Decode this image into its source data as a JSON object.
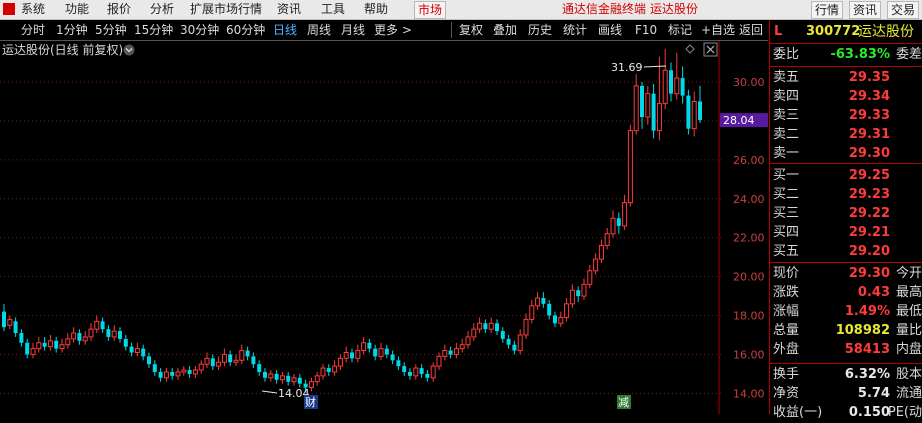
{
  "menubar": {
    "items": [
      "系统",
      "功能",
      "报价",
      "分析",
      "扩展市场行情",
      "资讯",
      "工具",
      "帮助"
    ],
    "market_tab": "市场",
    "title_prefix": "通达信金融终端",
    "title_stock": "运达股份",
    "right_buttons": [
      "行情",
      "资讯",
      "交易"
    ]
  },
  "toolbar": {
    "periods": [
      "分时",
      "1分钟",
      "5分钟",
      "15分钟",
      "30分钟",
      "60分钟",
      "日线",
      "周线",
      "月线",
      "更多 >"
    ],
    "active_period": "日线",
    "actions": [
      "复权",
      "叠加",
      "历史",
      "统计",
      "画线",
      "F10",
      "标记",
      "+自选",
      "返回"
    ]
  },
  "chart": {
    "title": "运达股份(日线 前复权)",
    "current_price_label": "28.04",
    "high_label": "31.69",
    "low_label": "14.04",
    "marker_cai": "财",
    "marker_jian": "减",
    "colors": {
      "up": "#ff3b3b",
      "down": "#00d9e8",
      "grid": "#7a1414",
      "tag_bg": "#5a1aa0"
    }
  },
  "chart_data": {
    "type": "candlestick",
    "y_ticks": [
      14.0,
      16.0,
      18.0,
      20.0,
      22.0,
      24.0,
      26.0,
      28.0,
      30.0
    ],
    "ylim": [
      13.3,
      31.9
    ],
    "annotations": {
      "max": 31.69,
      "min": 14.04,
      "last": 28.04
    },
    "candles": [
      [
        18.2,
        17.4,
        18.6,
        17.2
      ],
      [
        17.5,
        17.8,
        18.0,
        17.3
      ],
      [
        17.7,
        17.1,
        17.9,
        16.9
      ],
      [
        17.1,
        16.6,
        17.3,
        16.4
      ],
      [
        16.6,
        16.0,
        16.8,
        15.8
      ],
      [
        16.0,
        16.3,
        16.6,
        15.8
      ],
      [
        16.3,
        16.6,
        16.9,
        16.1
      ],
      [
        16.6,
        16.4,
        16.9,
        16.2
      ],
      [
        16.4,
        16.7,
        17.0,
        16.2
      ],
      [
        16.7,
        16.3,
        16.9,
        16.1
      ],
      [
        16.3,
        16.5,
        16.8,
        16.1
      ],
      [
        16.5,
        16.8,
        17.1,
        16.3
      ],
      [
        16.8,
        17.1,
        17.4,
        16.6
      ],
      [
        17.1,
        16.7,
        17.3,
        16.5
      ],
      [
        16.7,
        16.9,
        17.2,
        16.5
      ],
      [
        16.9,
        17.3,
        17.6,
        16.7
      ],
      [
        17.3,
        17.7,
        18.0,
        17.1
      ],
      [
        17.7,
        17.3,
        17.9,
        17.1
      ],
      [
        17.3,
        16.9,
        17.5,
        16.7
      ],
      [
        16.9,
        17.2,
        17.5,
        16.7
      ],
      [
        17.2,
        16.8,
        17.4,
        16.6
      ],
      [
        16.8,
        16.4,
        17.0,
        16.2
      ],
      [
        16.4,
        16.1,
        16.6,
        15.9
      ],
      [
        16.1,
        16.3,
        16.6,
        15.9
      ],
      [
        16.3,
        15.9,
        16.5,
        15.7
      ],
      [
        15.9,
        15.5,
        16.1,
        15.3
      ],
      [
        15.5,
        15.1,
        15.7,
        14.9
      ],
      [
        15.1,
        14.8,
        15.3,
        14.6
      ],
      [
        14.8,
        15.1,
        15.3,
        14.6
      ],
      [
        15.1,
        14.9,
        15.3,
        14.7
      ],
      [
        14.9,
        15.1,
        15.3,
        14.7
      ],
      [
        15.1,
        15.2,
        15.4,
        14.9
      ],
      [
        15.2,
        15.0,
        15.4,
        14.8
      ],
      [
        15.0,
        15.2,
        15.4,
        14.8
      ],
      [
        15.2,
        15.5,
        15.7,
        15.0
      ],
      [
        15.5,
        15.8,
        16.1,
        15.3
      ],
      [
        15.8,
        15.4,
        16.0,
        15.2
      ],
      [
        15.4,
        15.6,
        15.9,
        15.2
      ],
      [
        15.6,
        16.0,
        16.3,
        15.4
      ],
      [
        16.0,
        15.6,
        16.2,
        15.4
      ],
      [
        15.6,
        15.7,
        16.0,
        15.4
      ],
      [
        15.7,
        16.2,
        16.5,
        15.5
      ],
      [
        16.2,
        15.9,
        16.4,
        15.7
      ],
      [
        15.9,
        15.5,
        16.1,
        15.3
      ],
      [
        15.5,
        15.1,
        15.7,
        14.9
      ],
      [
        15.1,
        14.8,
        15.3,
        14.6
      ],
      [
        14.8,
        15.0,
        15.2,
        14.6
      ],
      [
        15.0,
        14.7,
        15.2,
        14.5
      ],
      [
        14.7,
        14.9,
        15.1,
        14.5
      ],
      [
        14.9,
        14.6,
        15.1,
        14.4
      ],
      [
        14.6,
        14.8,
        15.0,
        14.4
      ],
      [
        14.8,
        14.5,
        15.0,
        14.3
      ],
      [
        14.5,
        14.3,
        14.7,
        14.04
      ],
      [
        14.3,
        14.6,
        14.8,
        14.1
      ],
      [
        14.6,
        14.9,
        15.1,
        14.4
      ],
      [
        14.9,
        15.3,
        15.5,
        14.7
      ],
      [
        15.3,
        15.1,
        15.5,
        14.9
      ],
      [
        15.1,
        15.4,
        15.7,
        14.9
      ],
      [
        15.4,
        15.8,
        16.0,
        15.2
      ],
      [
        15.8,
        16.1,
        16.4,
        15.6
      ],
      [
        16.1,
        15.8,
        16.3,
        15.6
      ],
      [
        15.8,
        16.2,
        16.5,
        15.6
      ],
      [
        16.2,
        16.6,
        16.9,
        16.0
      ],
      [
        16.6,
        16.3,
        16.8,
        16.1
      ],
      [
        16.3,
        15.9,
        16.5,
        15.7
      ],
      [
        15.9,
        16.3,
        16.6,
        15.7
      ],
      [
        16.3,
        16.0,
        16.5,
        15.8
      ],
      [
        16.0,
        15.7,
        16.2,
        15.5
      ],
      [
        15.7,
        15.4,
        15.9,
        15.2
      ],
      [
        15.4,
        15.1,
        15.6,
        14.9
      ],
      [
        15.1,
        14.9,
        15.3,
        14.7
      ],
      [
        14.9,
        15.3,
        15.5,
        14.7
      ],
      [
        15.3,
        15.0,
        15.5,
        14.8
      ],
      [
        15.0,
        14.8,
        15.2,
        14.6
      ],
      [
        14.8,
        15.4,
        15.6,
        14.6
      ],
      [
        15.4,
        15.9,
        16.1,
        15.2
      ],
      [
        15.9,
        16.2,
        16.5,
        15.7
      ],
      [
        16.2,
        16.0,
        16.4,
        15.8
      ],
      [
        16.0,
        16.3,
        16.6,
        15.8
      ],
      [
        16.3,
        16.5,
        16.8,
        16.1
      ],
      [
        16.5,
        16.9,
        17.2,
        16.3
      ],
      [
        16.9,
        17.3,
        17.6,
        16.7
      ],
      [
        17.3,
        17.6,
        17.9,
        17.1
      ],
      [
        17.6,
        17.3,
        17.8,
        17.1
      ],
      [
        17.3,
        17.6,
        17.9,
        17.1
      ],
      [
        17.6,
        17.2,
        17.8,
        17.0
      ],
      [
        17.2,
        16.8,
        17.4,
        16.6
      ],
      [
        16.8,
        16.5,
        17.0,
        16.3
      ],
      [
        16.5,
        16.2,
        16.7,
        16.0
      ],
      [
        16.2,
        17.0,
        17.3,
        16.0
      ],
      [
        17.0,
        17.8,
        18.1,
        16.8
      ],
      [
        17.8,
        18.5,
        18.8,
        17.6
      ],
      [
        18.5,
        18.9,
        19.2,
        18.3
      ],
      [
        18.9,
        18.6,
        19.2,
        18.4
      ],
      [
        18.6,
        18.0,
        18.8,
        17.8
      ],
      [
        18.0,
        17.6,
        18.2,
        17.4
      ],
      [
        17.6,
        17.9,
        18.2,
        17.4
      ],
      [
        17.9,
        18.6,
        18.9,
        17.7
      ],
      [
        18.6,
        19.3,
        19.6,
        18.4
      ],
      [
        19.3,
        19.0,
        19.5,
        18.7
      ],
      [
        19.0,
        19.6,
        19.9,
        18.8
      ],
      [
        19.6,
        20.3,
        20.6,
        19.4
      ],
      [
        20.3,
        20.9,
        21.2,
        20.1
      ],
      [
        20.9,
        21.6,
        21.9,
        20.7
      ],
      [
        21.6,
        22.2,
        22.5,
        21.4
      ],
      [
        22.2,
        23.0,
        23.4,
        22.0
      ],
      [
        23.0,
        22.6,
        23.3,
        22.2
      ],
      [
        22.6,
        23.8,
        24.2,
        22.4
      ],
      [
        23.8,
        27.5,
        27.8,
        23.6
      ],
      [
        27.5,
        29.8,
        30.4,
        27.3
      ],
      [
        29.8,
        28.2,
        30.0,
        27.6
      ],
      [
        28.2,
        29.4,
        29.8,
        27.8
      ],
      [
        29.4,
        27.5,
        29.9,
        27.1
      ],
      [
        27.5,
        28.9,
        31.3,
        27.0
      ],
      [
        28.9,
        30.6,
        31.69,
        28.6
      ],
      [
        30.6,
        29.4,
        31.0,
        29.0
      ],
      [
        29.4,
        30.2,
        31.5,
        29.1
      ],
      [
        30.2,
        29.3,
        30.8,
        28.9
      ],
      [
        29.3,
        27.6,
        29.6,
        27.3
      ],
      [
        27.6,
        29.0,
        29.5,
        27.2
      ],
      [
        29.0,
        28.04,
        29.8,
        27.9
      ]
    ]
  },
  "panel": {
    "code": "300772",
    "name": "运达股份",
    "l_mark": "L",
    "weibi_label": "委比",
    "weibi_value": "-63.83%",
    "weicha_label": "委差",
    "sells": [
      {
        "label": "卖五",
        "price": "29.35"
      },
      {
        "label": "卖四",
        "price": "29.34"
      },
      {
        "label": "卖三",
        "price": "29.33"
      },
      {
        "label": "卖二",
        "price": "29.31"
      },
      {
        "label": "卖一",
        "price": "29.30"
      }
    ],
    "buys": [
      {
        "label": "买一",
        "price": "29.25"
      },
      {
        "label": "买二",
        "price": "29.23"
      },
      {
        "label": "买三",
        "price": "29.22"
      },
      {
        "label": "买四",
        "price": "29.21"
      },
      {
        "label": "买五",
        "price": "29.20"
      }
    ],
    "stats": [
      {
        "label": "现价",
        "value": "29.30",
        "label2": "今开",
        "color": "#ff3b3b"
      },
      {
        "label": "涨跌",
        "value": "0.43",
        "label2": "最高",
        "color": "#ff3b3b"
      },
      {
        "label": "涨幅",
        "value": "1.49%",
        "label2": "最低",
        "color": "#ff3b3b"
      },
      {
        "label": "总量",
        "value": "108982",
        "label2": "量比",
        "color": "#e8e832"
      },
      {
        "label": "外盘",
        "value": "58413",
        "label2": "内盘",
        "color": "#ff3b3b"
      }
    ],
    "stats2": [
      {
        "label": "换手",
        "value": "6.32%",
        "label2": "股本",
        "color": "#e8e8e8"
      },
      {
        "label": "净资",
        "value": "5.74",
        "label2": "流通",
        "color": "#e8e8e8"
      },
      {
        "label": "收益(一)",
        "value": "0.150",
        "label2": "PE(动",
        "color": "#e8e8e8"
      }
    ]
  }
}
